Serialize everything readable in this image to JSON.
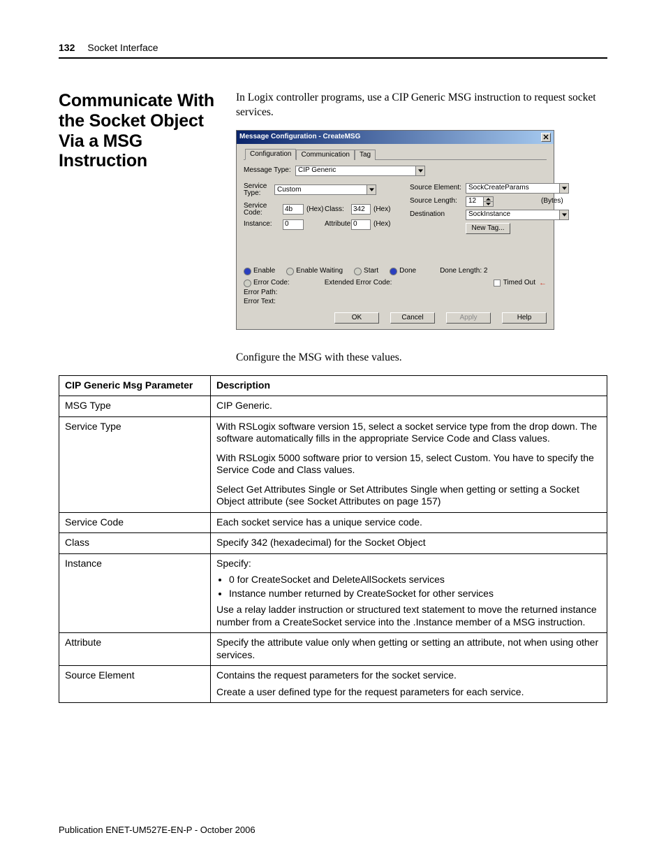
{
  "header": {
    "page_no": "132",
    "chapter": "Socket Interface"
  },
  "section_title": "Communicate With the Socket Object Via a MSG Instruction",
  "intro_1": "In Logix controller programs, use a CIP Generic MSG instruction to request socket services.",
  "intro_2": "Configure the MSG with these values.",
  "dialog": {
    "title": "Message Configuration - CreateMSG",
    "tabs": {
      "configuration": "Configuration",
      "communication": "Communication",
      "tag": "Tag"
    },
    "message_type_label": "Message Type:",
    "message_type_value": "CIP Generic",
    "service_type_label": "Service Type:",
    "service_type_value": "Custom",
    "service_code_label": "Service Code:",
    "service_code_value": "4b",
    "class_label": "Class:",
    "class_value": "342",
    "instance_label": "Instance:",
    "instance_value": "0",
    "attribute_label": "Attribute:",
    "attribute_value": "0",
    "hex_label": "(Hex)",
    "source_element_label": "Source Element:",
    "source_element_value": "SockCreateParams",
    "source_length_label": "Source Length:",
    "source_length_value": "12",
    "bytes_label": "(Bytes)",
    "destination_label": "Destination",
    "destination_value": "SockInstance",
    "new_tag": "New Tag...",
    "status": {
      "enable": "Enable",
      "enable_waiting": "Enable Waiting",
      "start": "Start",
      "done": "Done",
      "done_length": "Done Length: 2",
      "error_code": "Error Code:",
      "extended_error_code": "Extended Error Code:",
      "timed_out": "Timed Out",
      "error_path": "Error Path:",
      "error_text": "Error Text:"
    },
    "buttons": {
      "ok": "OK",
      "cancel": "Cancel",
      "apply": "Apply",
      "help": "Help"
    }
  },
  "table": {
    "col1": "CIP Generic Msg Parameter",
    "col2": "Description",
    "rows": {
      "msg_type": {
        "param": "MSG Type",
        "desc": "CIP Generic."
      },
      "service_type": {
        "param": "Service Type",
        "p1": "With RSLogix software version 15, select a socket service type from the drop down. The software automatically fills in the appropriate Service Code and Class values.",
        "p2": "With RSLogix 5000 software prior to version 15, select Custom. You have to specify the Service Code and Class values.",
        "p3": "Select Get Attributes Single or Set Attributes Single when getting or setting a Socket Object attribute (see Socket Attributes on page 157)"
      },
      "service_code": {
        "param": "Service Code",
        "desc": "Each socket service has a unique service code."
      },
      "class": {
        "param": "Class",
        "desc": "Specify 342 (hexadecimal) for the Socket Object"
      },
      "instance": {
        "param": "Instance",
        "lead": "Specify:",
        "b1": "0 for CreateSocket and DeleteAllSockets services",
        "b2": "Instance number returned by CreateSocket for other services",
        "tail": "Use a relay ladder instruction or structured text statement to move the returned instance number from a CreateSocket service into the .Instance member of a MSG instruction."
      },
      "attribute": {
        "param": "Attribute",
        "desc": "Specify the attribute value only when getting or setting an attribute, not when using other services."
      },
      "source_element": {
        "param": "Source Element",
        "p1": "Contains the request parameters for the socket service.",
        "p2": "Create a user defined type for the request parameters for each service."
      }
    }
  },
  "footer": "Publication ENET-UM527E-EN-P - October 2006"
}
